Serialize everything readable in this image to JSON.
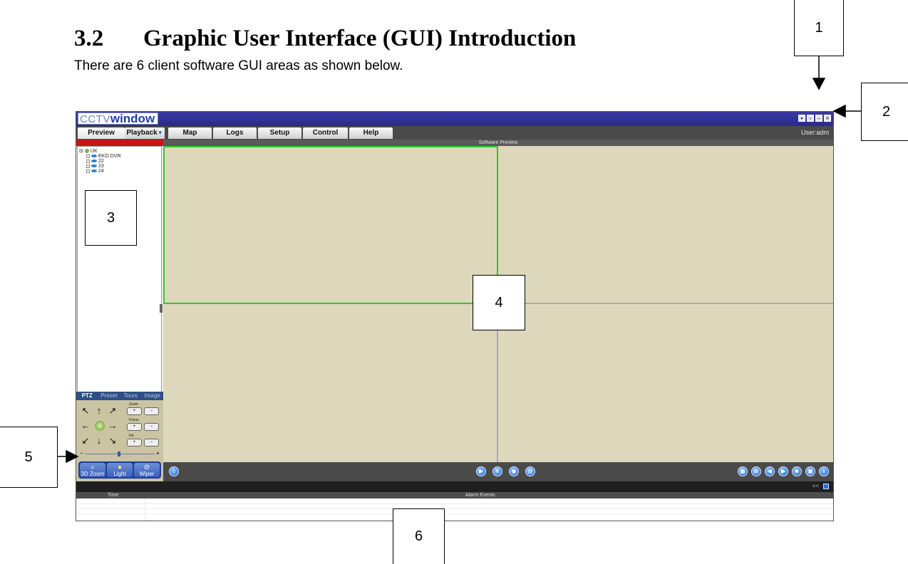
{
  "section": {
    "number": "3.2",
    "title": "Graphic User Interface (GUI) Introduction"
  },
  "intro": "There are 6 client software GUI areas as shown below.",
  "callouts": [
    "1",
    "2",
    "3",
    "4",
    "5",
    "6"
  ],
  "app": {
    "logo_part1": "CCTV",
    "logo_part2": "window",
    "window_controls": [
      "pin-icon",
      "restore-icon",
      "minimize-icon",
      "close-icon"
    ],
    "menu_tabs": [
      "Preview",
      "Playback",
      "Map",
      "Logs",
      "Setup",
      "Control",
      "Help"
    ],
    "active_tab": "Preview",
    "user_label": "User:adm",
    "tree": {
      "root": "UK",
      "devices": [
        "EKO DVR",
        "22",
        "23",
        "24"
      ]
    },
    "ptz": {
      "tabs": [
        "PTZ",
        "Preset",
        "Tours",
        "Image"
      ],
      "active_tab": "PTZ",
      "lens_labels": [
        "Zoom",
        "Focus",
        "Iris"
      ],
      "buttons": [
        "3D Zoom",
        "Light",
        "Wiper"
      ]
    },
    "preview_title": "Software Preview",
    "alarm": {
      "columns": [
        "Time",
        "Alarm Events"
      ],
      "collapse_label": "<<"
    },
    "colors": {
      "titlebar": "#2a2a8c",
      "menubar": "#4a4a4a",
      "left_header": "#c81414",
      "preview_bg": "#ddd7bc",
      "active_pane": "#2ec82e",
      "grid_line": "#a9a9a9",
      "toolbar": "#4a4a4a"
    }
  }
}
